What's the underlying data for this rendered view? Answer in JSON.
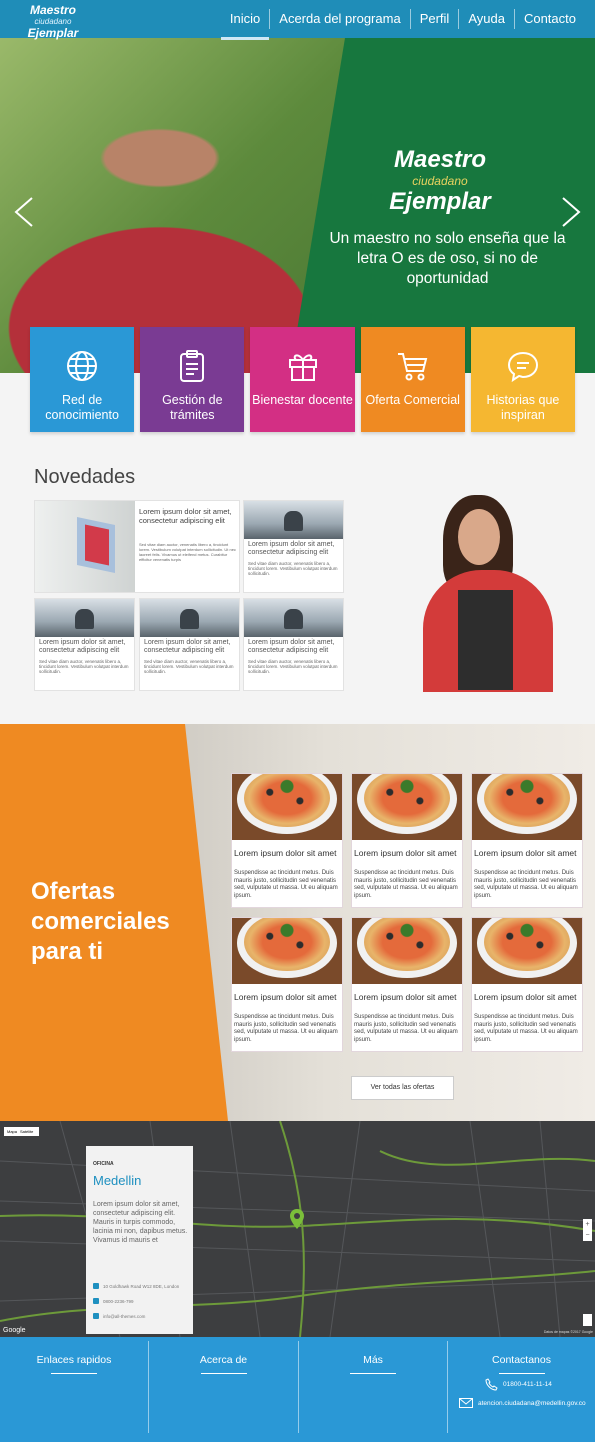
{
  "header": {
    "logo": {
      "line1": "Maestro",
      "line2": "ciudadano",
      "line3": "Ejemplar"
    },
    "nav": [
      {
        "label": "Inicio",
        "active": true
      },
      {
        "label": "Acerda del programa",
        "active": false
      },
      {
        "label": "Perfil",
        "active": false
      },
      {
        "label": "Ayuda",
        "active": false
      },
      {
        "label": "Contacto",
        "active": false
      }
    ],
    "color": "#1f8db8"
  },
  "hero": {
    "logo": {
      "line1": "Maestro",
      "line2": "ciudadano",
      "line3": "Ejemplar"
    },
    "tagline": "Un  maestro no solo enseña que la letra O es de oso, si no de oportunidad",
    "green": "#17773e"
  },
  "tiles": [
    {
      "label": "Red de conocimiento",
      "icon": "globe-icon",
      "color": "#2a98d6"
    },
    {
      "label": "Gestión de trámites",
      "icon": "clipboard-icon",
      "color": "#7a3b93"
    },
    {
      "label": "Bienestar docente",
      "icon": "gift-icon",
      "color": "#d32f84"
    },
    {
      "label": "Oferta Comercial",
      "icon": "cart-icon",
      "color": "#ef8a22"
    },
    {
      "label": "Historias que inspiran",
      "icon": "chat-icon",
      "color": "#f5b731"
    }
  ],
  "novedades": {
    "title": "Novedades",
    "featured": {
      "title": "Lorem ipsum dolor sit amet, consectetur adipiscing elit",
      "desc": "Sed vitae diam auctor, venenatis libero a, tincidunt lorem. Vestibulum volutpat interdum sollicitudin. Ut nec laoreet felis. Vivamus ut eleifend metus. Curabitur efficitur venenatis turpis"
    },
    "cards": [
      {
        "title": "Lorem ipsum dolor sit amet, consectetur adipiscing elit",
        "desc": "Sed vitae diam auctor, venenatis libero a, tincidunt lorem. Vestibulum volutpat interdum sollicitudin."
      },
      {
        "title": "Lorem ipsum dolor sit amet, consectetur adipiscing elit",
        "desc": "Sed vitae diam auctor, venenatis libero a, tincidunt lorem. Vestibulum volutpat interdum sollicitudin."
      },
      {
        "title": "Lorem ipsum dolor sit amet, consectetur adipiscing elit",
        "desc": "Sed vitae diam auctor, venenatis libero a, tincidunt lorem. Vestibulum volutpat interdum sollicitudin."
      },
      {
        "title": "Lorem ipsum dolor sit amet, consectetur adipiscing elit",
        "desc": "Sed vitae diam auctor, venenatis libero a, tincidunt lorem. Vestibulum volutpat interdum sollicitudin."
      }
    ]
  },
  "offers": {
    "title": "Ofertas comerciales para ti",
    "card_title": "Lorem ipsum dolor sit amet",
    "card_desc": "Suspendisse ac tincidunt metus. Duis mauris justo, sollicitudin sed venenatis sed, vulputate ut massa. Ut eu aliquam ipsum.",
    "button": "Ver todas las ofertas",
    "orange": "#ef8a22"
  },
  "map": {
    "tabs": [
      "Mapa",
      "Satélite"
    ],
    "google": "Google",
    "credit": "Datos de mapas ©2017 Google",
    "office": {
      "kicker": "OFICINA",
      "city": "Medellin",
      "desc": "Lorem ipsum dolor sit amet, consectetur adipiscing elit. Mauris in turpis commodo, lacinia mi non, dapibus metus. Vivamus id mauris et",
      "address": "10 Goldhawk Road W12 8DE, London",
      "phone": "0800-2236-799",
      "email": "info@all-themes.com"
    }
  },
  "footer": {
    "cols": [
      "Enlaces rapidos",
      "Acerca de",
      "Más",
      "Contactanos"
    ],
    "phone": "01800-411-11-14",
    "email": "atencion.ciudadana@medellin.gov.co",
    "color": "#2a98d6"
  }
}
